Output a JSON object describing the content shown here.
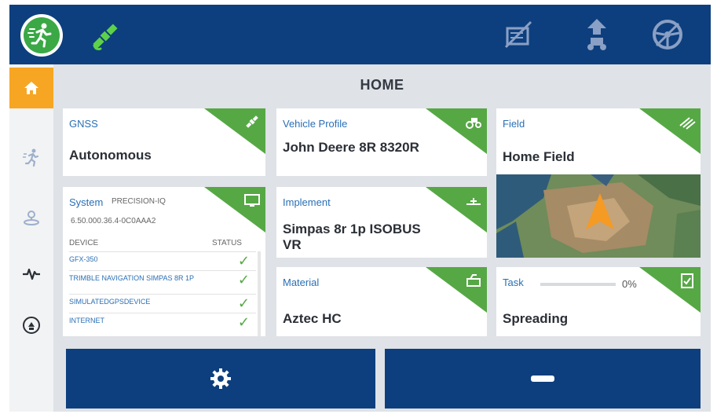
{
  "page": {
    "title": "HOME"
  },
  "topbar": {
    "run_icon": "running-person-icon",
    "gnss_status_icon": "satellite-icon",
    "right_icons": [
      "field-boundary-disabled-icon",
      "guidance-upload-icon",
      "steering-disabled-icon"
    ]
  },
  "sidebar": {
    "items": [
      {
        "name": "home",
        "icon": "home-icon",
        "active": true
      },
      {
        "name": "run",
        "icon": "running-person-icon",
        "active": false
      },
      {
        "name": "location",
        "icon": "location-pin-icon",
        "active": false
      },
      {
        "name": "diagnostics",
        "icon": "pulse-icon",
        "active": false
      },
      {
        "name": "isobus",
        "icon": "isobus-icon",
        "active": false
      }
    ]
  },
  "cards": {
    "gnss": {
      "label": "GNSS",
      "value": "Autonomous",
      "icon": "satellite-icon"
    },
    "vehicle": {
      "label": "Vehicle Profile",
      "value": "John Deere 8R 8320R",
      "icon": "tractor-icon"
    },
    "field": {
      "label": "Field",
      "value": "Home Field",
      "icon": "field-lines-icon"
    },
    "system": {
      "label": "System",
      "subtitle": "PRECISION-IQ",
      "version": "6.50.000.36.4-0C0AAA2",
      "headers": {
        "device": "DEVICE",
        "status": "STATUS"
      },
      "devices": [
        {
          "name": "GFX-350",
          "status": "ok"
        },
        {
          "name": "TRIMBLE NAVIGATION SIMPAS 8R 1P",
          "status": "ok"
        },
        {
          "name": "SIMULATEDGPSDEVICE",
          "status": "ok"
        },
        {
          "name": "INTERNET",
          "status": "ok"
        }
      ],
      "icon": "monitor-icon"
    },
    "implement": {
      "label": "Implement",
      "value": "Simpas 8r 1p ISOBUS VR",
      "icon": "implement-icon"
    },
    "material": {
      "label": "Material",
      "value": "Aztec HC",
      "icon": "material-icon"
    },
    "task": {
      "label": "Task",
      "value": "Spreading",
      "progress_percent": "0%",
      "progress": 0,
      "icon": "clipboard-check-icon"
    }
  },
  "buttons": {
    "settings_icon": "gear-icon",
    "remove_icon": "minus-icon"
  },
  "colors": {
    "topbar": "#0d3f7e",
    "accent_green": "#56a845",
    "active_tab": "#f6a623",
    "label_blue": "#2a6fb5"
  }
}
